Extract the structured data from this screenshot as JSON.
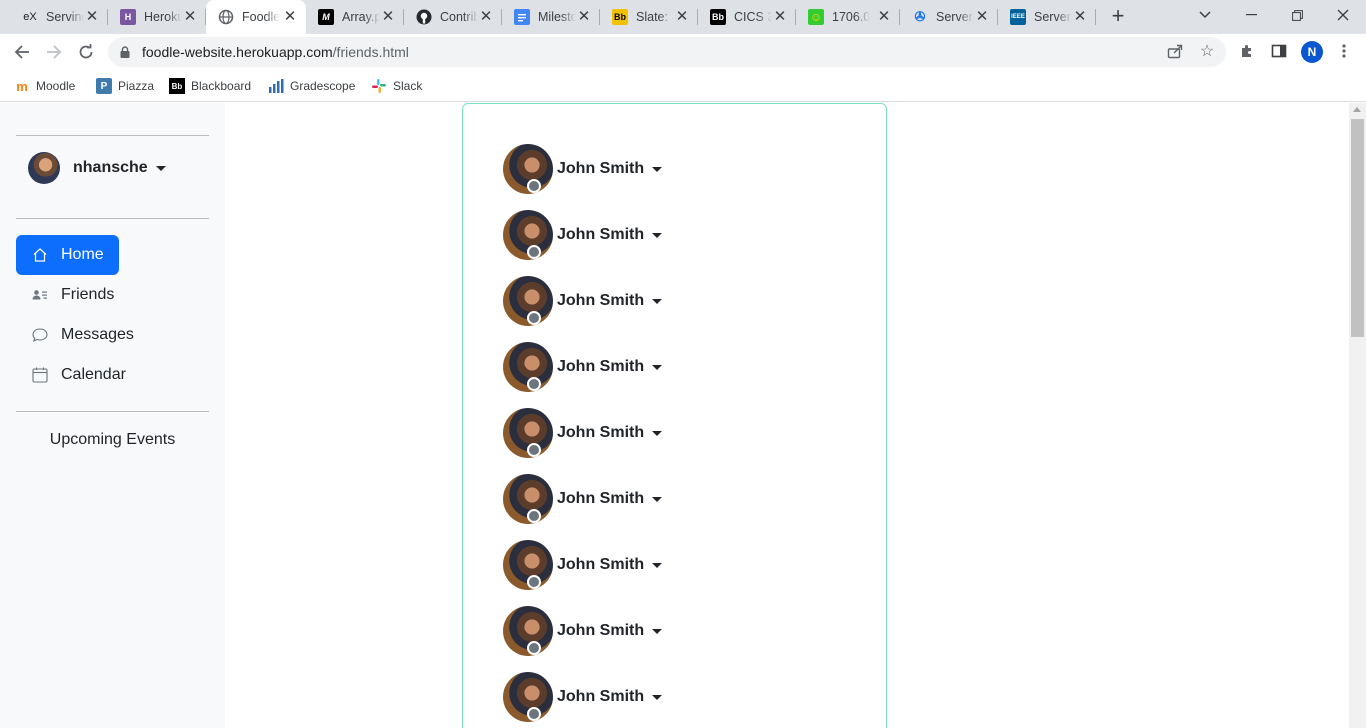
{
  "browser": {
    "tabs": [
      {
        "title": "Serving",
        "favicon": "ex",
        "color": "#ffffff",
        "fgcolor": "#202124"
      },
      {
        "title": "Heroku",
        "favicon": "H",
        "color": "#79589f",
        "fgcolor": "#ffffff"
      },
      {
        "title": "Foodle",
        "favicon": "globe",
        "color": "#ffffff",
        "fgcolor": "#5f6368",
        "active": true
      },
      {
        "title": "Array.p",
        "favicon": "M",
        "color": "#000000",
        "fgcolor": "#ffffff"
      },
      {
        "title": "Contrib",
        "favicon": "github",
        "color": "#ffffff",
        "fgcolor": "#24292f"
      },
      {
        "title": "Milesto",
        "favicon": "doc",
        "color": "#4285f4",
        "fgcolor": "#ffffff"
      },
      {
        "title": "Slate: ",
        "favicon": "Bb",
        "color": "#f2c200",
        "fgcolor": "#000000"
      },
      {
        "title": "CICS 3",
        "favicon": "Bb",
        "color": "#000000",
        "fgcolor": "#ffffff"
      },
      {
        "title": "1706.0",
        "favicon": "smiley",
        "color": "#33cc33",
        "fgcolor": "#ffdd00"
      },
      {
        "title": "Server",
        "favicon": "swirl",
        "color": "#ffffff",
        "fgcolor": "#1a73e8"
      },
      {
        "title": "Server",
        "favicon": "IEEE",
        "color": "#00629b",
        "fgcolor": "#ffffff"
      }
    ],
    "url_host": "foodle-website.herokuapp.com",
    "url_path": "/friends.html",
    "profile_initial": "N",
    "bookmarks": [
      {
        "label": "Moodle",
        "icon": "moodle-icon",
        "color": "#f98012"
      },
      {
        "label": "Piazza",
        "icon": "piazza-icon",
        "color": "#3e7aab"
      },
      {
        "label": "Blackboard",
        "icon": "blackboard-icon",
        "color": "#000000"
      },
      {
        "label": "Gradescope",
        "icon": "gradescope-icon",
        "color": "#2d6db5"
      },
      {
        "label": "Slack",
        "icon": "slack-icon",
        "color": "#e01e5a"
      }
    ]
  },
  "sidebar": {
    "username": "nhansche",
    "nav": [
      {
        "label": "Home",
        "icon": "home-icon",
        "active": true
      },
      {
        "label": "Friends",
        "icon": "friends-icon"
      },
      {
        "label": "Messages",
        "icon": "chat-icon"
      },
      {
        "label": "Calendar",
        "icon": "calendar-icon"
      }
    ],
    "upcoming_label": "Upcoming Events"
  },
  "friends": [
    {
      "name": "John Smith"
    },
    {
      "name": "John Smith"
    },
    {
      "name": "John Smith"
    },
    {
      "name": "John Smith"
    },
    {
      "name": "John Smith"
    },
    {
      "name": "John Smith"
    },
    {
      "name": "John Smith"
    },
    {
      "name": "John Smith"
    },
    {
      "name": "John Smith"
    }
  ],
  "colors": {
    "accent": "#0d6efd",
    "card_border": "#7fe0c4",
    "sidebar_bg": "#f8f9fa",
    "status_offline": "#6c757d"
  }
}
